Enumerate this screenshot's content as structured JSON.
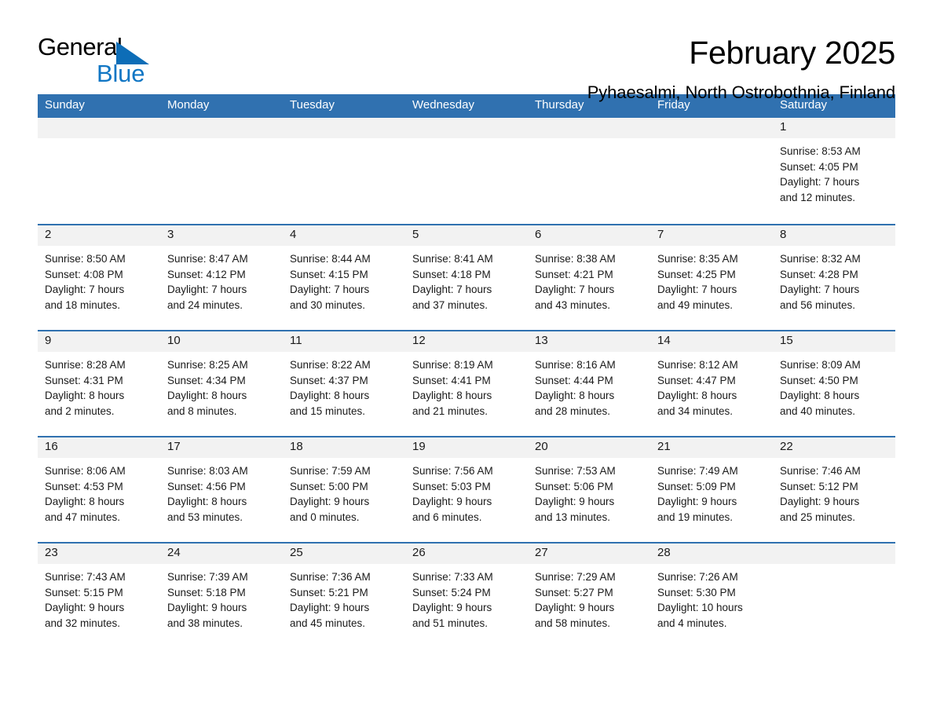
{
  "brand": {
    "name_top": "General",
    "name_bottom": "Blue",
    "accent_color": "#1076c4",
    "triangle_color": "#0d6db7"
  },
  "header": {
    "title": "February 2025",
    "subtitle": "Pyhaesalmi, North Ostrobothnia, Finland"
  },
  "theme": {
    "header_blue": "#3071b0",
    "row_rule_blue": "#3071b0",
    "day_band_gray": "#f2f2f2"
  },
  "weekdays": [
    "Sunday",
    "Monday",
    "Tuesday",
    "Wednesday",
    "Thursday",
    "Friday",
    "Saturday"
  ],
  "weeks": [
    [
      {
        "day": "",
        "lines": []
      },
      {
        "day": "",
        "lines": []
      },
      {
        "day": "",
        "lines": []
      },
      {
        "day": "",
        "lines": []
      },
      {
        "day": "",
        "lines": []
      },
      {
        "day": "",
        "lines": []
      },
      {
        "day": "1",
        "lines": [
          "Sunrise: 8:53 AM",
          "Sunset: 4:05 PM",
          "Daylight: 7 hours",
          "and 12 minutes."
        ]
      }
    ],
    [
      {
        "day": "2",
        "lines": [
          "Sunrise: 8:50 AM",
          "Sunset: 4:08 PM",
          "Daylight: 7 hours",
          "and 18 minutes."
        ]
      },
      {
        "day": "3",
        "lines": [
          "Sunrise: 8:47 AM",
          "Sunset: 4:12 PM",
          "Daylight: 7 hours",
          "and 24 minutes."
        ]
      },
      {
        "day": "4",
        "lines": [
          "Sunrise: 8:44 AM",
          "Sunset: 4:15 PM",
          "Daylight: 7 hours",
          "and 30 minutes."
        ]
      },
      {
        "day": "5",
        "lines": [
          "Sunrise: 8:41 AM",
          "Sunset: 4:18 PM",
          "Daylight: 7 hours",
          "and 37 minutes."
        ]
      },
      {
        "day": "6",
        "lines": [
          "Sunrise: 8:38 AM",
          "Sunset: 4:21 PM",
          "Daylight: 7 hours",
          "and 43 minutes."
        ]
      },
      {
        "day": "7",
        "lines": [
          "Sunrise: 8:35 AM",
          "Sunset: 4:25 PM",
          "Daylight: 7 hours",
          "and 49 minutes."
        ]
      },
      {
        "day": "8",
        "lines": [
          "Sunrise: 8:32 AM",
          "Sunset: 4:28 PM",
          "Daylight: 7 hours",
          "and 56 minutes."
        ]
      }
    ],
    [
      {
        "day": "9",
        "lines": [
          "Sunrise: 8:28 AM",
          "Sunset: 4:31 PM",
          "Daylight: 8 hours",
          "and 2 minutes."
        ]
      },
      {
        "day": "10",
        "lines": [
          "Sunrise: 8:25 AM",
          "Sunset: 4:34 PM",
          "Daylight: 8 hours",
          "and 8 minutes."
        ]
      },
      {
        "day": "11",
        "lines": [
          "Sunrise: 8:22 AM",
          "Sunset: 4:37 PM",
          "Daylight: 8 hours",
          "and 15 minutes."
        ]
      },
      {
        "day": "12",
        "lines": [
          "Sunrise: 8:19 AM",
          "Sunset: 4:41 PM",
          "Daylight: 8 hours",
          "and 21 minutes."
        ]
      },
      {
        "day": "13",
        "lines": [
          "Sunrise: 8:16 AM",
          "Sunset: 4:44 PM",
          "Daylight: 8 hours",
          "and 28 minutes."
        ]
      },
      {
        "day": "14",
        "lines": [
          "Sunrise: 8:12 AM",
          "Sunset: 4:47 PM",
          "Daylight: 8 hours",
          "and 34 minutes."
        ]
      },
      {
        "day": "15",
        "lines": [
          "Sunrise: 8:09 AM",
          "Sunset: 4:50 PM",
          "Daylight: 8 hours",
          "and 40 minutes."
        ]
      }
    ],
    [
      {
        "day": "16",
        "lines": [
          "Sunrise: 8:06 AM",
          "Sunset: 4:53 PM",
          "Daylight: 8 hours",
          "and 47 minutes."
        ]
      },
      {
        "day": "17",
        "lines": [
          "Sunrise: 8:03 AM",
          "Sunset: 4:56 PM",
          "Daylight: 8 hours",
          "and 53 minutes."
        ]
      },
      {
        "day": "18",
        "lines": [
          "Sunrise: 7:59 AM",
          "Sunset: 5:00 PM",
          "Daylight: 9 hours",
          "and 0 minutes."
        ]
      },
      {
        "day": "19",
        "lines": [
          "Sunrise: 7:56 AM",
          "Sunset: 5:03 PM",
          "Daylight: 9 hours",
          "and 6 minutes."
        ]
      },
      {
        "day": "20",
        "lines": [
          "Sunrise: 7:53 AM",
          "Sunset: 5:06 PM",
          "Daylight: 9 hours",
          "and 13 minutes."
        ]
      },
      {
        "day": "21",
        "lines": [
          "Sunrise: 7:49 AM",
          "Sunset: 5:09 PM",
          "Daylight: 9 hours",
          "and 19 minutes."
        ]
      },
      {
        "day": "22",
        "lines": [
          "Sunrise: 7:46 AM",
          "Sunset: 5:12 PM",
          "Daylight: 9 hours",
          "and 25 minutes."
        ]
      }
    ],
    [
      {
        "day": "23",
        "lines": [
          "Sunrise: 7:43 AM",
          "Sunset: 5:15 PM",
          "Daylight: 9 hours",
          "and 32 minutes."
        ]
      },
      {
        "day": "24",
        "lines": [
          "Sunrise: 7:39 AM",
          "Sunset: 5:18 PM",
          "Daylight: 9 hours",
          "and 38 minutes."
        ]
      },
      {
        "day": "25",
        "lines": [
          "Sunrise: 7:36 AM",
          "Sunset: 5:21 PM",
          "Daylight: 9 hours",
          "and 45 minutes."
        ]
      },
      {
        "day": "26",
        "lines": [
          "Sunrise: 7:33 AM",
          "Sunset: 5:24 PM",
          "Daylight: 9 hours",
          "and 51 minutes."
        ]
      },
      {
        "day": "27",
        "lines": [
          "Sunrise: 7:29 AM",
          "Sunset: 5:27 PM",
          "Daylight: 9 hours",
          "and 58 minutes."
        ]
      },
      {
        "day": "28",
        "lines": [
          "Sunrise: 7:26 AM",
          "Sunset: 5:30 PM",
          "Daylight: 10 hours",
          "and 4 minutes."
        ]
      },
      {
        "day": "",
        "lines": []
      }
    ]
  ]
}
